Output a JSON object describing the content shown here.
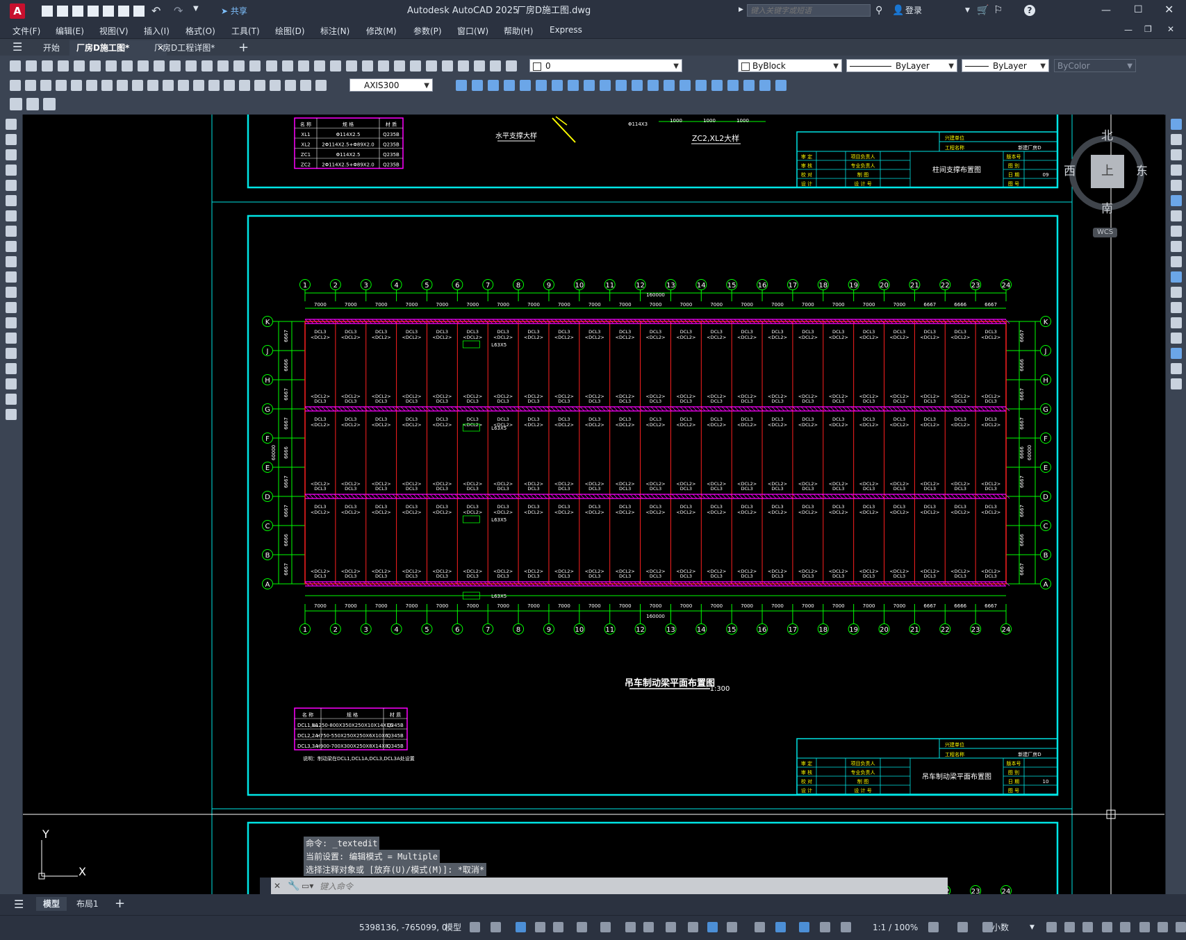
{
  "window": {
    "app_title": "Autodesk AutoCAD 2025",
    "file_title": "厂房D施工图.dwg",
    "share_label": "共享",
    "search_placeholder": "键入关键字或短语",
    "login_label": "登录"
  },
  "menu": [
    "文件(F)",
    "编辑(E)",
    "视图(V)",
    "插入(I)",
    "格式(O)",
    "工具(T)",
    "绘图(D)",
    "标注(N)",
    "修改(M)",
    "参数(P)",
    "窗口(W)",
    "帮助(H)",
    "Express"
  ],
  "doc_tabs": [
    {
      "label": "开始",
      "active": false
    },
    {
      "label": "厂房D施工图*",
      "active": true
    },
    {
      "label": "厂房D工程详图*",
      "active": false
    }
  ],
  "toolbar": {
    "layer_value": "0",
    "color_value": "ByBlock",
    "linetype_value": "ByLayer",
    "lineweight_value": "ByLayer",
    "plotstyle_value": "ByColor",
    "dimstyle_value": "AXIS300"
  },
  "viewcube": {
    "north": "北",
    "south": "南",
    "east": "东",
    "west": "西",
    "top": "上",
    "wcs": "WCS"
  },
  "drawing": {
    "upper_table": {
      "headers": [
        "名 称",
        "规 格",
        "材 质"
      ],
      "rows": [
        [
          "XL1",
          "Φ114X2.5",
          "Q235B"
        ],
        [
          "XL2",
          "2Φ114X2.5+Φ89X2.0",
          "Q235B"
        ],
        [
          "ZC1",
          "Φ114X2.5",
          "Q235B"
        ],
        [
          "ZC2",
          "2Φ114X2.5+Φ89X2.0",
          "Q235B"
        ]
      ]
    },
    "upper_labels": {
      "detail1": "水平支撑大样",
      "detail2": "ZC2,XL2大样",
      "dims": [
        "1000",
        "1000",
        "1000"
      ],
      "pipe": "Φ114X3"
    },
    "title_block_1": {
      "owner": "兴建单位",
      "project": "工程名称",
      "project_value": "新建厂房D",
      "drawing_name": "柱间支撑布置图",
      "sheet_no": "09",
      "rows": [
        [
          "审 定",
          "项目负责人"
        ],
        [
          "审 核",
          "专业负责人"
        ],
        [
          "校 对",
          "制 图"
        ],
        [
          "设 计",
          "设 计 号"
        ]
      ],
      "right_labels": [
        "版本号",
        "图 别",
        "日 期",
        "图 号"
      ]
    },
    "axis_numbers": [
      "1",
      "2",
      "3",
      "4",
      "5",
      "6",
      "7",
      "8",
      "9",
      "10",
      "11",
      "12",
      "13",
      "14",
      "15",
      "16",
      "17",
      "18",
      "19",
      "20",
      "21",
      "22",
      "23",
      "24"
    ],
    "axis_letters": [
      "K",
      "J",
      "H",
      "G",
      "F",
      "E",
      "D",
      "C",
      "B",
      "A"
    ],
    "bay_dims": [
      "7000",
      "7000",
      "7000",
      "7000",
      "7000",
      "7000",
      "7000",
      "7000",
      "7000",
      "7000",
      "7000",
      "7000",
      "7000",
      "7000",
      "7000",
      "7000",
      "7000",
      "7000",
      "7000",
      "7000",
      "6667",
      "6666",
      "6667"
    ],
    "total_dim": "160000",
    "side_dims": [
      "6667",
      "6666",
      "6667",
      "6667",
      "6666",
      "6667",
      "6667",
      "6666",
      "6667"
    ],
    "side_total": "60000",
    "beam_label_top": "DCL3",
    "beam_label_bottom": "<DCL2>",
    "brace_label": "L63X5",
    "plan_title": "吊车制动梁平面布置图",
    "plan_scale": "1:300",
    "lower_table": {
      "headers": [
        "名 称",
        "规 格",
        "材 质"
      ],
      "rows": [
        [
          "DCL1,1A",
          "H1250-800X350X250X10X14X16",
          "Q345B"
        ],
        [
          "DCL2,2A",
          "H750-550X250X250X6X10X6",
          "Q345B"
        ],
        [
          "DCL3,3A",
          "H900-700X300X250X8X14X8",
          "Q345B"
        ]
      ],
      "note": "说明：制动梁在DCL1,DCL1A,DCL3,DCL3A处设置"
    },
    "title_block_2": {
      "owner": "兴建单位",
      "project": "工程名称",
      "project_value": "新建厂房D",
      "drawing_name": "吊车制动梁平面布置图",
      "sheet_no": "10",
      "rows": [
        [
          "审 定",
          "项目负责人"
        ],
        [
          "审 核",
          "专业负责人"
        ],
        [
          "校 对",
          "制 图"
        ],
        [
          "设 计",
          "设 计 号"
        ]
      ],
      "right_labels": [
        "版本号",
        "图 别",
        "日 期",
        "图 号"
      ]
    }
  },
  "command": {
    "history": [
      "命令: _textedit",
      "当前设置: 编辑模式 = Multiple",
      "选择注释对象或 [放弃(U)/模式(M)]: *取消*"
    ],
    "placeholder": "键入命令"
  },
  "ucs": {
    "x": "X",
    "y": "Y"
  },
  "layout_tabs": [
    "模型",
    "布局1"
  ],
  "status": {
    "coords": "5398136, -765099, 0",
    "model": "模型",
    "scale": "1:1 / 100%",
    "units": "小数"
  },
  "colors": {
    "cyan": "#00e5e5",
    "green": "#00ff00",
    "red": "#ff2020",
    "magenta": "#ff00ff",
    "yellow": "#ffff00",
    "white": "#ffffff"
  }
}
